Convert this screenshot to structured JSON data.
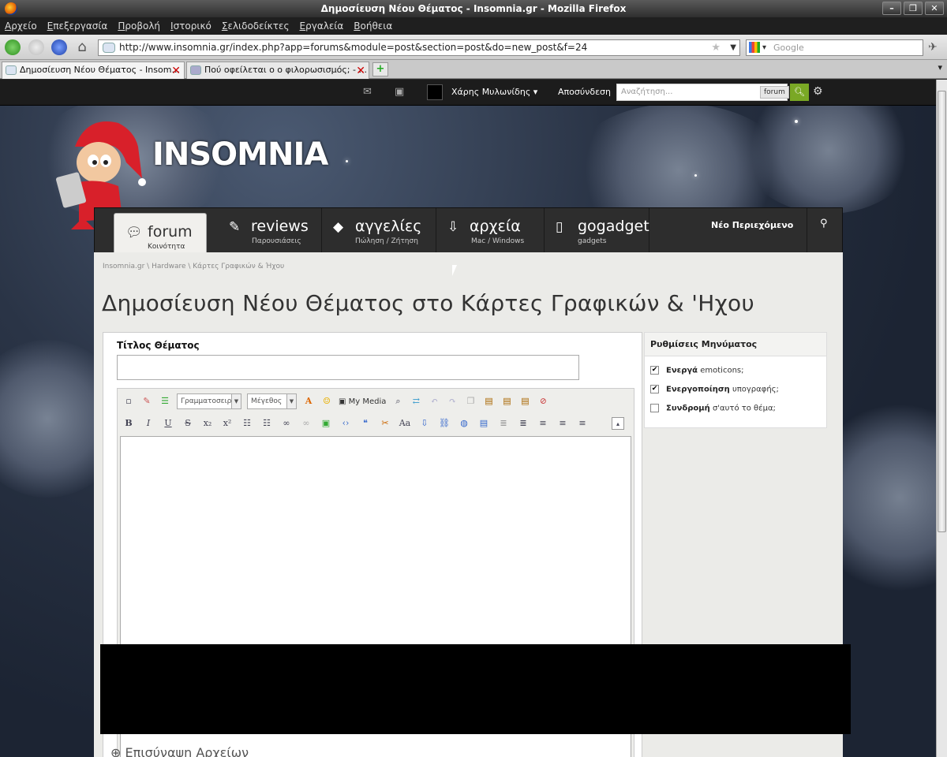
{
  "window": {
    "title": "Δημοσίευση Νέου Θέματος - Insomnia.gr - Mozilla Firefox"
  },
  "menu": [
    "Αρχείο",
    "Επεξεργασία",
    "Προβολή",
    "Ιστορικό",
    "Σελιδοδείκτες",
    "Εργαλεία",
    "Βοήθεια"
  ],
  "urlbar": {
    "url": "http://www.insomnia.gr/index.php?app=forums&module=post&section=post&do=new_post&f=24"
  },
  "search": {
    "placeholder": "Google"
  },
  "tabs": [
    {
      "label": "Δημοσίευση Νέου Θέματος - Insom..."
    },
    {
      "label": "Πού οφείλεται ο ο φιλορωσισμός; - ..."
    }
  ],
  "site": {
    "username": "Χάρης Μυλωνίδης",
    "username_caret": "▾",
    "logout": "Αποσύνδεση",
    "search_placeholder": "Αναζήτηση...",
    "search_scope": "forum",
    "logo": "INSOMNIA",
    "nav": [
      {
        "label": "forum",
        "sub": "Κοινότητα"
      },
      {
        "label": "reviews",
        "sub": "Παρουσιάσεις"
      },
      {
        "label": "αγγελίες",
        "sub": "Πώληση / Ζήτηση"
      },
      {
        "label": "αρχεία",
        "sub": "Mac / Windows"
      },
      {
        "label": "gogadget",
        "sub": "gadgets"
      }
    ],
    "new_content": "Νέο Περιεχόμενο"
  },
  "breadcrumb": "Insomnia.gr  \\  Hardware  \\  Κάρτες Γραφικών & Ήχου",
  "page_title": "Δημοσίευση Νέου Θέματος στο Κάρτες Γραφικών & 'Ηχου",
  "form": {
    "title_label": "Τίτλος Θέματος",
    "title_value": "",
    "font_select": "Γραμματοσειρά",
    "size_select": "Μέγεθος",
    "my_media": "My Media"
  },
  "settings": {
    "heading": "Ρυθμίσεις Μηνύματος",
    "options": [
      {
        "bold": "Ενεργά",
        "rest": " emoticons;",
        "checked": true,
        "mark": "✔"
      },
      {
        "bold": "Ενεργοποίηση",
        "rest": " υπογραφής;",
        "checked": true,
        "mark": "✔"
      },
      {
        "bold": "Συνδρομή",
        "rest": " σ'αυτό το θέμα;",
        "checked": false,
        "mark": ""
      }
    ]
  },
  "attachments_peek": "⊕  Επισύναψη Αρχείων",
  "colors": {
    "accent": "#7aa825",
    "nav_bg": "#2d2d2d",
    "content_bg": "#ebebe8"
  }
}
